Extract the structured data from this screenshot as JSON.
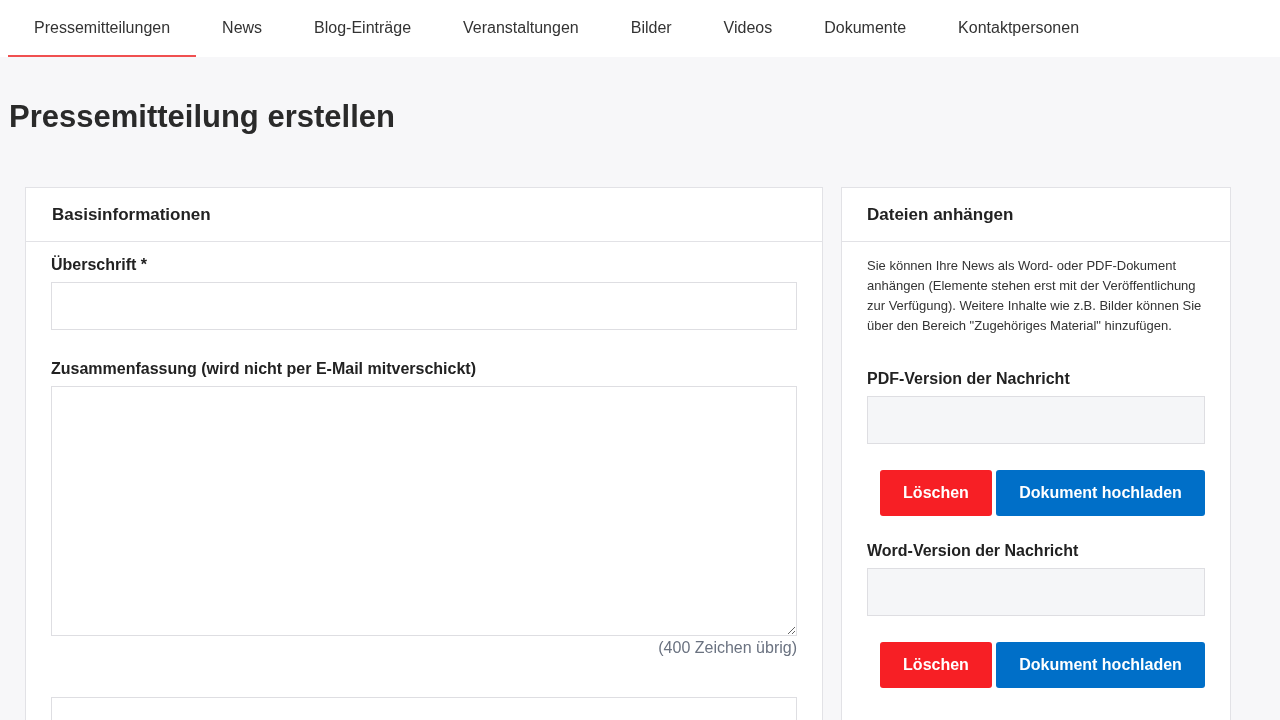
{
  "tabs": [
    {
      "label": "Pressemitteilungen",
      "selected": true
    },
    {
      "label": "News",
      "selected": false
    },
    {
      "label": "Blog-Einträge",
      "selected": false
    },
    {
      "label": "Veranstaltungen",
      "selected": false
    },
    {
      "label": "Bilder",
      "selected": false
    },
    {
      "label": "Videos",
      "selected": false
    },
    {
      "label": "Dokumente",
      "selected": false
    },
    {
      "label": "Kontaktpersonen",
      "selected": false
    }
  ],
  "page_title": "Pressemitteilung erstellen",
  "basic_info": {
    "title": "Basisinformationen",
    "headline_label": "Überschrift *",
    "summary_label": "Zusammenfassung (wird nicht per E-Mail mitverschickt)",
    "summary_counter": "(400 Zeichen übrig)"
  },
  "attachments": {
    "title": "Dateien anhängen",
    "description": "Sie können Ihre News als Word- oder PDF-Dokument anhängen (Elemente stehen erst mit der Veröffentlichung zur Verfügung). Weitere Inhalte wie z.B. Bilder können Sie über den Bereich \"Zugehöriges Material\" hinzufügen.",
    "files": [
      {
        "label": "PDF-Version der Nachricht",
        "delete_button": "Löschen",
        "upload_button": "Dokument hochladen"
      },
      {
        "label": "Word-Version der Nachricht",
        "delete_button": "Löschen",
        "upload_button": "Dokument hochladen"
      }
    ]
  }
}
